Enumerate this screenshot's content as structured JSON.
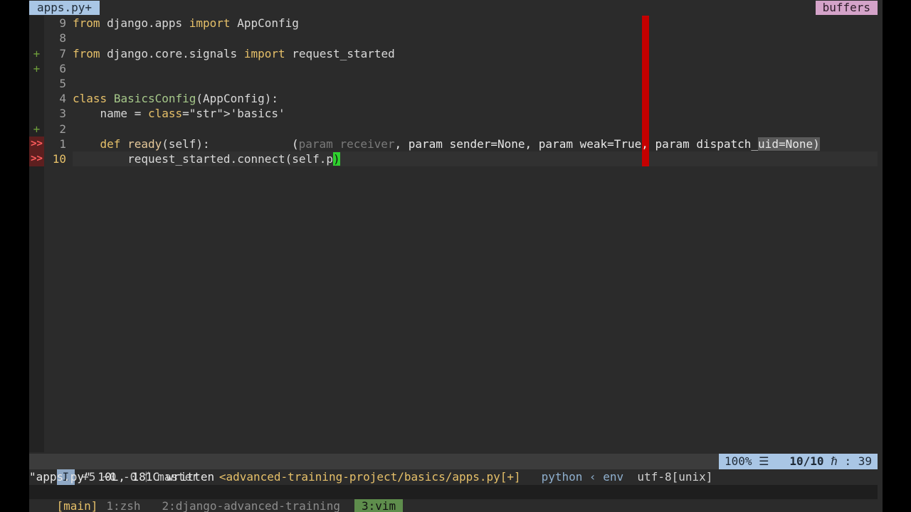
{
  "tabline": {
    "active_tab": "apps.py+",
    "buffers_label": "buffers"
  },
  "editor": {
    "lines": [
      {
        "sign": "",
        "num": "9",
        "text": "from django.apps import AppConfig"
      },
      {
        "sign": "",
        "num": "8",
        "text": ""
      },
      {
        "sign": "+",
        "num": "7",
        "text": "from django.core.signals import request_started"
      },
      {
        "sign": "+",
        "num": "6",
        "text": ""
      },
      {
        "sign": "",
        "num": "5",
        "text": ""
      },
      {
        "sign": "",
        "num": "4",
        "text": "class BasicsConfig(AppConfig):"
      },
      {
        "sign": "",
        "num": "3",
        "text": "    name = 'basics'"
      },
      {
        "sign": "+",
        "num": "2",
        "text": ""
      },
      {
        "sign": ">>",
        "num": "1",
        "text": "    def ready(self):"
      },
      {
        "sign": ">>",
        "num": "10",
        "text": "        request_started.connect(self.p)"
      }
    ],
    "signature_hint": "(param receiver, param sender=None, param weak=True, param dispatch_uid=None)"
  },
  "statusline": {
    "mode": "I",
    "git": "+5 ~0 -0 ᚶ master",
    "path": "<advanced-training-project/basics/apps.py[+]",
    "filetype": "python ‹ env",
    "encoding": "utf-8[unix]",
    "percent": "100% ☰",
    "position": "10/10",
    "column": "ℏ : 39"
  },
  "message": "\"apps.py\" 10L, 181C written",
  "tmux": {
    "session": "[main]",
    "windows": [
      "1:zsh",
      "2:django-advanced-training",
      "3:vim"
    ],
    "active_window": "3:vim"
  }
}
